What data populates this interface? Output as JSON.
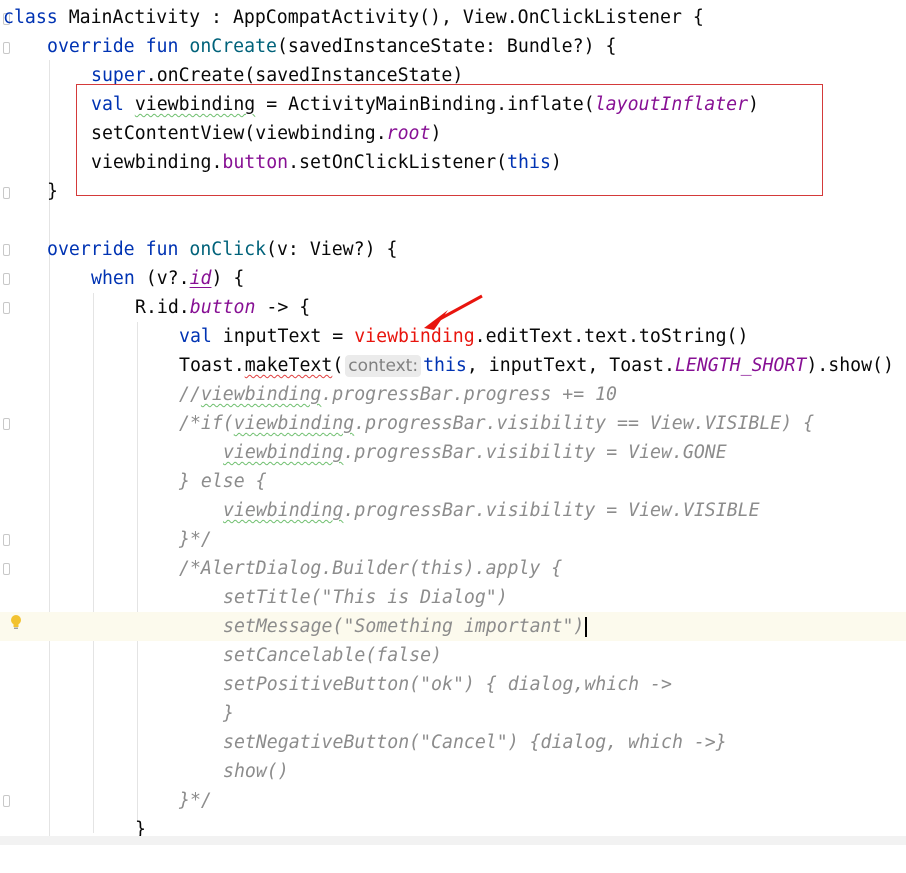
{
  "editor": {
    "lines": {
      "l1": {
        "kw_class": "class",
        "name": " MainActivity : AppCompatActivity(), View.OnClickListener {"
      },
      "l2": {
        "kw_override": "override",
        "kw_fun": "fun",
        "fn": "onCreate",
        "rest": "(savedInstanceState: Bundle?) {"
      },
      "l3": {
        "kw_super": "super",
        "rest": ".onCreate(savedInstanceState)"
      },
      "l4": {
        "kw_val": "val",
        "var": "viewbinding",
        "mid": " = ActivityMainBinding.inflate(",
        "param": "layoutInflater",
        "end": ")"
      },
      "l5": {
        "pre": "setContentView(viewbinding.",
        "prop": "root",
        "end": ")"
      },
      "l6": {
        "pre": "viewbinding.",
        "prop": "button",
        "mid": ".setOnClickListener(",
        "kw_this": "this",
        "end": ")"
      },
      "l7": {
        "brace": "}"
      },
      "l9": {
        "kw_override": "override",
        "kw_fun": "fun",
        "fn": "onClick",
        "rest": "(v: View?) {"
      },
      "l10": {
        "kw_when": "when",
        "pre": " (v?.",
        "prop": "id",
        "end": ") {"
      },
      "l11": {
        "pre": "R.id.",
        "prop": "button",
        "end": " -> {"
      },
      "l12": {
        "kw_val": "val",
        "var": " inputText = ",
        "red": "viewbinding",
        "rest": ".editText.text.toString()"
      },
      "l13": {
        "pre": "Toast.",
        "fn": "makeText",
        "paren": "(",
        "hint": "context:",
        "kw_this": "this",
        "mid": ", inputText, Toast.",
        "const": "LENGTH_SHORT",
        "end": ").show()"
      },
      "l14": {
        "c1": "//",
        "c2": "viewbinding",
        "c3": ".progressBar.progress += 10"
      },
      "l15": {
        "c1": "/*if(",
        "c2": "viewbinding",
        "c3": ".progressBar.visibility == View.VISIBLE) {"
      },
      "l16": {
        "c2": "viewbinding",
        "c3": ".progressBar.visibility = View.GONE"
      },
      "l17": {
        "c1": "} else {"
      },
      "l18": {
        "c2": "viewbinding",
        "c3": ".progressBar.visibility = View.VISIBLE"
      },
      "l19": {
        "c1": "}*/"
      },
      "l20": {
        "c1": "/*AlertDialog.Builder(this).apply {"
      },
      "l21": {
        "c1": "setTitle(\"This is Dialog\")"
      },
      "l22": {
        "c1": "setMessage(\"Something important\")"
      },
      "l23": {
        "c1": "setCancelable(false)"
      },
      "l24": {
        "c1": "setPositiveButton(\"ok\") { dialog,which ->"
      },
      "l25": {
        "c1": "}"
      },
      "l26": {
        "c1": "setNegativeButton(\"Cancel\") {dialog, which ->}"
      },
      "l27": {
        "c1": "show()"
      },
      "l28": {
        "c1": "}*/"
      },
      "l29": {
        "brace": "}"
      }
    },
    "colors": {
      "keyword": "#0033b3",
      "function": "#00627a",
      "property": "#871094",
      "comment": "#8c8c8c",
      "highlight_red": "#e8150e",
      "annotation_box": "#d43a3a",
      "current_line": "#fcfaed"
    },
    "icons": {
      "intention_bulb": "lightbulb-icon",
      "annotation_arrow": "red-arrow-icon"
    }
  }
}
